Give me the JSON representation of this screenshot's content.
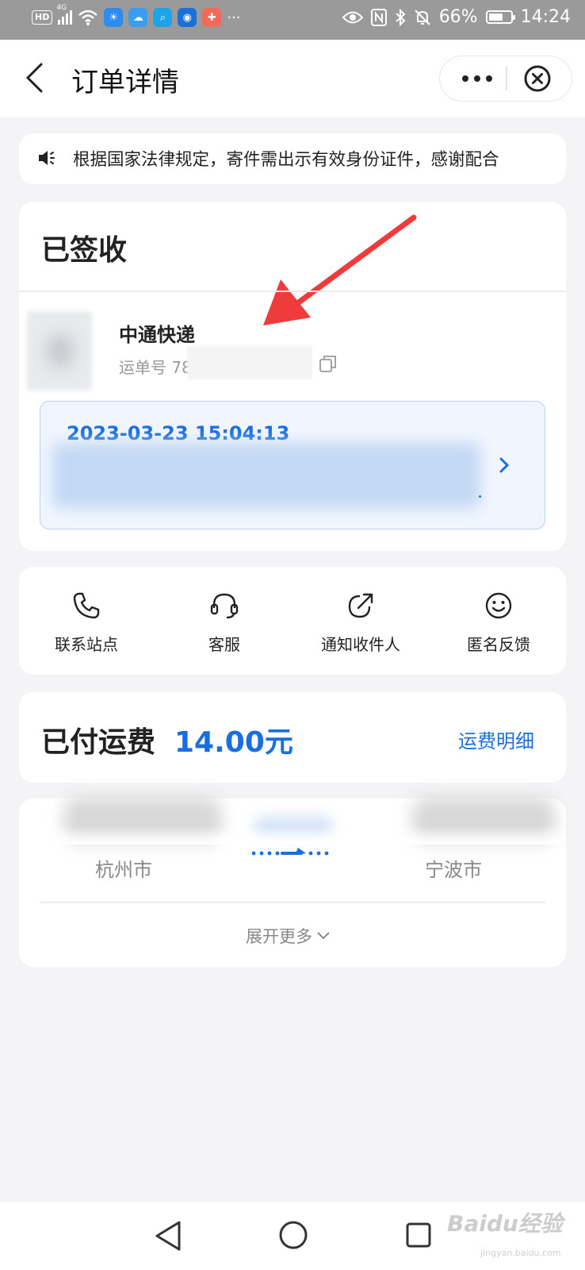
{
  "status_bar": {
    "hd_badge": "HD",
    "signal_label": "4G",
    "more": "···",
    "battery": "66%",
    "battery_level": 0.66,
    "time": "14:24",
    "icons": [
      "hd-icon",
      "signal-icon",
      "wifi-icon",
      "weather-app-icon",
      "cloud-app-icon",
      "search-app-icon",
      "robot-app-icon",
      "tools-app-icon",
      "eye-icon",
      "nfc-icon",
      "bluetooth-icon",
      "mute-icon",
      "battery-icon"
    ]
  },
  "header": {
    "title": "订单详情",
    "back_icon": "chevron-left-icon",
    "more_icon": "more-dots-icon",
    "close_icon": "close-circle-icon"
  },
  "notice": {
    "icon": "speaker-icon",
    "text": "根据国家法律规定，寄件需出示有效身份证件，感谢配合"
  },
  "order": {
    "status": "已签收",
    "courier_name": "中通快递",
    "waybill_label": "运单号 78",
    "copy_icon": "copy-icon",
    "latest_track_time": "2023-03-23 15:04:13",
    "track_arrow_icon": "chevron-right-icon"
  },
  "actions": [
    {
      "label": "联系站点",
      "icon": "phone-icon"
    },
    {
      "label": "客服",
      "icon": "headset-icon"
    },
    {
      "label": "通知收件人",
      "icon": "share-arrow-icon"
    },
    {
      "label": "匿名反馈",
      "icon": "smile-icon"
    }
  ],
  "fee": {
    "label": "已付运费",
    "amount": "14.00元",
    "detail_link": "运费明细"
  },
  "route": {
    "from_city": "杭州市",
    "to_city": "宁波市",
    "expand_label": "展开更多",
    "expand_icon": "chevron-down-icon"
  },
  "nav_bar": {
    "icons": [
      "nav-back-icon",
      "nav-home-icon",
      "nav-recent-icon"
    ]
  },
  "watermark": {
    "text": "Baidu经验",
    "sub": "jingyan.baidu.com"
  },
  "colors": {
    "accent": "#1a6fe0",
    "background": "#f4f4f6",
    "status_bar": "#9a9a9a",
    "annotation_arrow": "#ef3b3b"
  }
}
